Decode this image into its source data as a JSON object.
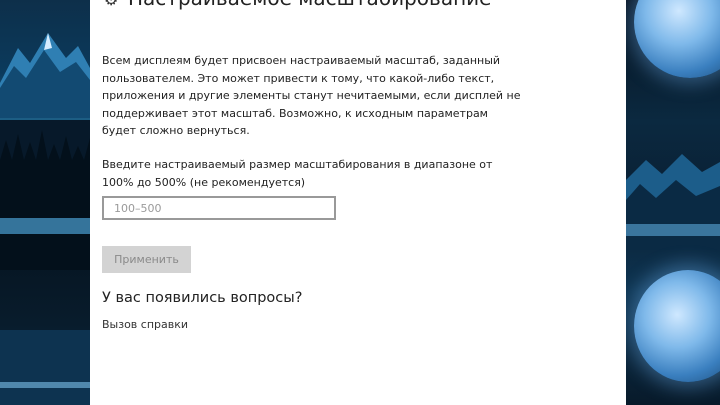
{
  "page": {
    "title": "Настраиваемое масштабирование",
    "title_icon": "gear-icon"
  },
  "content": {
    "description": "Всем дисплеям будет присвоен настраиваемый масштаб, заданный пользователем. Это может привести к тому, что какой-либо текст, приложения и другие элементы станут нечитаемыми, если дисплей не поддерживает этот масштаб. Возможно, к исходным параметрам будет сложно вернуться.",
    "input_prompt": "Введите настраиваемый размер масштабирования в диапазоне от 100%  до 500%  (не рекомендуется)",
    "scale_input": {
      "value": "",
      "placeholder": "100–500"
    },
    "apply_label": "Применить",
    "questions_heading": "У вас появились вопросы?",
    "help_link": "Вызов справки"
  },
  "colors": {
    "panel_background": "#ffffff",
    "disabled_button": "#d3d3d3",
    "wallpaper_blue": "#1d5f86"
  }
}
